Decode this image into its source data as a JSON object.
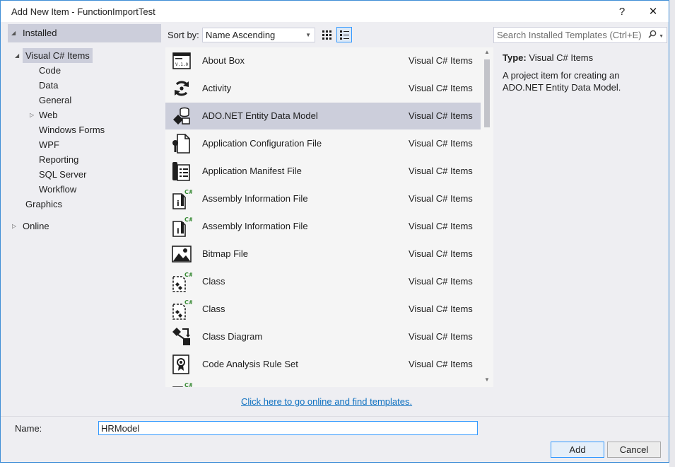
{
  "dialog": {
    "title": "Add New Item - FunctionImportTest",
    "help_label": "?",
    "close_label": "✕"
  },
  "tree": {
    "installed": "Installed",
    "visual_csharp": "Visual C# Items",
    "children": [
      "Code",
      "Data",
      "General",
      "Web",
      "Windows Forms",
      "WPF",
      "Reporting",
      "SQL Server",
      "Workflow"
    ],
    "graphics": "Graphics",
    "online": "Online"
  },
  "toolbar": {
    "sort_label": "Sort by:",
    "sort_value": "Name Ascending"
  },
  "search": {
    "placeholder": "Search Installed Templates (Ctrl+E)"
  },
  "items": [
    {
      "name": "About Box",
      "category": "Visual C# Items",
      "icon": "about-box-icon"
    },
    {
      "name": "Activity",
      "category": "Visual C# Items",
      "icon": "activity-icon"
    },
    {
      "name": "ADO.NET Entity Data Model",
      "category": "Visual C# Items",
      "icon": "entity-model-icon",
      "selected": true
    },
    {
      "name": "Application Configuration File",
      "category": "Visual C# Items",
      "icon": "config-file-icon"
    },
    {
      "name": "Application Manifest File",
      "category": "Visual C# Items",
      "icon": "manifest-file-icon"
    },
    {
      "name": "Assembly Information File",
      "category": "Visual C# Items",
      "icon": "assembly-info-icon"
    },
    {
      "name": "Assembly Information File",
      "category": "Visual C# Items",
      "icon": "assembly-info-icon"
    },
    {
      "name": "Bitmap File",
      "category": "Visual C# Items",
      "icon": "bitmap-icon"
    },
    {
      "name": "Class",
      "category": "Visual C# Items",
      "icon": "class-icon"
    },
    {
      "name": "Class",
      "category": "Visual C# Items",
      "icon": "class-icon"
    },
    {
      "name": "Class Diagram",
      "category": "Visual C# Items",
      "icon": "class-diagram-icon"
    },
    {
      "name": "Code Analysis Rule Set",
      "category": "Visual C# Items",
      "icon": "rule-set-icon"
    }
  ],
  "details": {
    "type_label": "Type:",
    "type_value": "Visual C# Items",
    "description": "A project item for creating an ADO.NET Entity Data Model."
  },
  "online_link": "Click here to go online and find templates.",
  "name_field": {
    "label": "Name:",
    "value": "HRModel"
  },
  "buttons": {
    "add": "Add",
    "cancel": "Cancel"
  },
  "colors": {
    "accent": "#3399ff",
    "selection": "#cccedb",
    "link": "#0e70c0",
    "csharp_badge": "#388a34"
  }
}
